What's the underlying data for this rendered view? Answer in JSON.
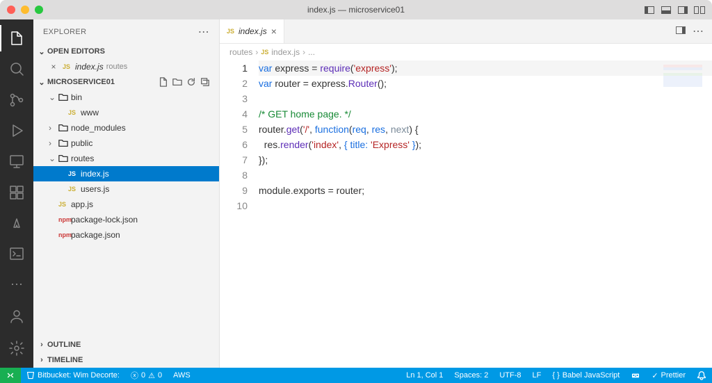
{
  "title": "index.js — microservice01",
  "sidebar": {
    "title": "EXPLORER",
    "sections": {
      "openEditors": {
        "label": "OPEN EDITORS",
        "items": [
          {
            "icon": "js",
            "name": "index.js",
            "subtle": "routes"
          }
        ]
      },
      "project": {
        "label": "MICROSERVICE01",
        "tree": [
          {
            "depth": 1,
            "chev": "down",
            "icon": "folder-red",
            "name": "bin"
          },
          {
            "depth": 2,
            "icon": "js",
            "name": "www"
          },
          {
            "depth": 1,
            "chev": "right",
            "icon": "folder",
            "name": "node_modules"
          },
          {
            "depth": 1,
            "chev": "right",
            "icon": "folder",
            "name": "public"
          },
          {
            "depth": 1,
            "chev": "down",
            "icon": "folder-green",
            "name": "routes"
          },
          {
            "depth": 2,
            "icon": "js",
            "name": "index.js",
            "selected": true
          },
          {
            "depth": 2,
            "icon": "js",
            "name": "users.js"
          },
          {
            "depth": 1,
            "icon": "js",
            "name": "app.js"
          },
          {
            "depth": 1,
            "icon": "npm",
            "name": "package-lock.json"
          },
          {
            "depth": 1,
            "icon": "npm",
            "name": "package.json"
          }
        ]
      },
      "outline": {
        "label": "OUTLINE"
      },
      "timeline": {
        "label": "TIMELINE"
      }
    }
  },
  "tabs": [
    {
      "icon": "js",
      "name": "index.js",
      "italic": true
    }
  ],
  "breadcrumb": [
    "routes",
    "index.js",
    "..."
  ],
  "code": {
    "lines": [
      {
        "n": 1,
        "current": true,
        "html": "<span class='kw'>var</span> express = <span class='fn'>require</span>(<span class='str'>'express'</span>);"
      },
      {
        "n": 2,
        "html": "<span class='kw'>var</span> router = express.<span class='fn'>Router</span>();"
      },
      {
        "n": 3,
        "html": ""
      },
      {
        "n": 4,
        "html": "<span class='cmt'>/* GET home page. */</span>"
      },
      {
        "n": 5,
        "html": "router.<span class='fn'>get</span>(<span class='str'>'/'</span>, <span class='kw'>function</span>(<span class='param'>req</span>, <span class='param'>res</span>, <span class='param2'>next</span>) {"
      },
      {
        "n": 6,
        "html": "  res.<span class='fn'>render</span>(<span class='str'>'index'</span>, <span class='prop'>{ title:</span> <span class='str'>'Express'</span> <span class='prop'>}</span>);"
      },
      {
        "n": 7,
        "html": "});"
      },
      {
        "n": 8,
        "html": ""
      },
      {
        "n": 9,
        "html": "module.exports = router;"
      },
      {
        "n": 10,
        "html": ""
      }
    ]
  },
  "status": {
    "bitbucket": "Bitbucket: Wim Decorte:",
    "errors": "0",
    "warnings": "0",
    "aws": "AWS",
    "cursor": "Ln 1, Col 1",
    "spaces": "Spaces: 2",
    "encoding": "UTF-8",
    "eol": "LF",
    "language": "Babel JavaScript",
    "prettier": "Prettier"
  }
}
